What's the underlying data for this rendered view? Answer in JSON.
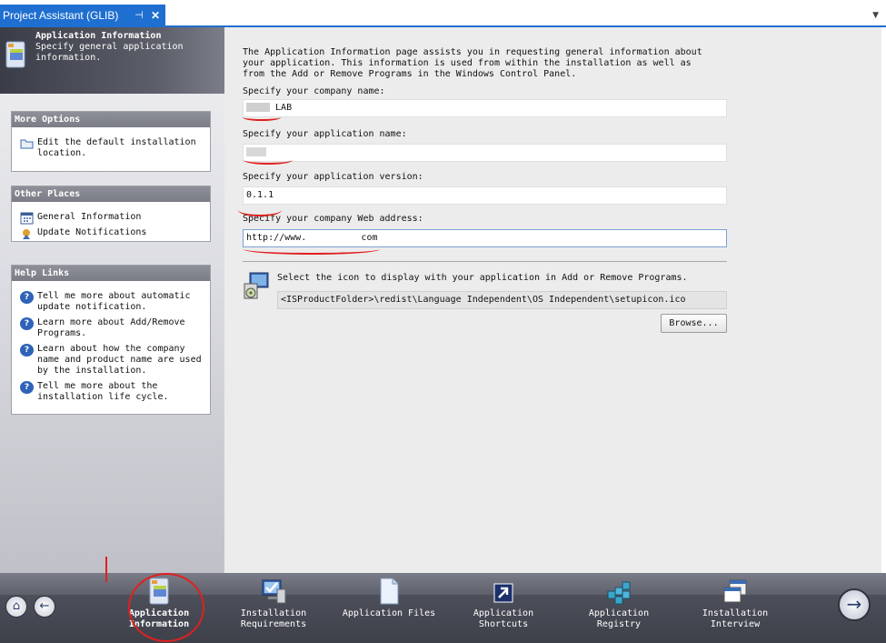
{
  "tab": {
    "title": "Project Assistant (GLIB)",
    "pin_glyph": "⊣",
    "close_glyph": "✕",
    "dropdown_glyph": "▼"
  },
  "banner": {
    "title": "Application Information",
    "description": "Specify general application information.",
    "icon": "application-info-icon"
  },
  "more_options": {
    "header": "More Options",
    "items": [
      {
        "label": "Edit the default installation location.",
        "icon": "folder-icon"
      }
    ]
  },
  "other_places": {
    "header": "Other Places",
    "items": [
      {
        "label": "General Information",
        "icon": "calendar-grid-icon"
      },
      {
        "label": "Update Notifications",
        "icon": "update-icon"
      }
    ]
  },
  "help_links": {
    "header": "Help Links",
    "items": [
      {
        "label": "Tell me more about automatic update notification.",
        "icon": "help-icon"
      },
      {
        "label": "Learn more about Add/Remove Programs.",
        "icon": "help-icon"
      },
      {
        "label": "Learn about how the company name and product name are used by the installation.",
        "icon": "help-icon"
      },
      {
        "label": "Tell me more about the installation life cycle.",
        "icon": "help-icon"
      }
    ]
  },
  "main": {
    "intro": "The Application Information page assists you in requesting general information about your application. This information is used from within the installation as well as from the Add or Remove Programs in the Windows Control Panel.",
    "company_name_label": "Specify your company name:",
    "company_name_value": "LAB",
    "app_name_label": "Specify your application name:",
    "app_name_value": "",
    "app_version_label": "Specify your application version:",
    "app_version_value": "0.1.1",
    "web_address_label": "Specify your company Web address:",
    "web_address_value": "http://www.          com",
    "icon_caption": "Select the icon to display with your application in Add or Remove Programs.",
    "icon_path": "<ISProductFolder>\\redist\\Language Independent\\OS Independent\\setupicon.ico",
    "browse_label": "Browse..."
  },
  "bottom_nav": {
    "home_glyph": "⌂",
    "back_glyph": "←",
    "next_glyph": "→",
    "items": [
      {
        "label": "Application Information",
        "icon": "application-info-icon",
        "active": true
      },
      {
        "label": "Installation Requirements",
        "icon": "monitor-check-icon",
        "active": false
      },
      {
        "label": "Application Files",
        "icon": "file-icon",
        "active": false
      },
      {
        "label": "Application Shortcuts",
        "icon": "shortcut-arrow-icon",
        "active": false
      },
      {
        "label": "Application Registry",
        "icon": "registry-cubes-icon",
        "active": false
      },
      {
        "label": "Installation Interview",
        "icon": "dialog-windows-icon",
        "active": false
      }
    ]
  },
  "colors": {
    "accent": "#1f6fd0",
    "annotation": "#e02020"
  }
}
